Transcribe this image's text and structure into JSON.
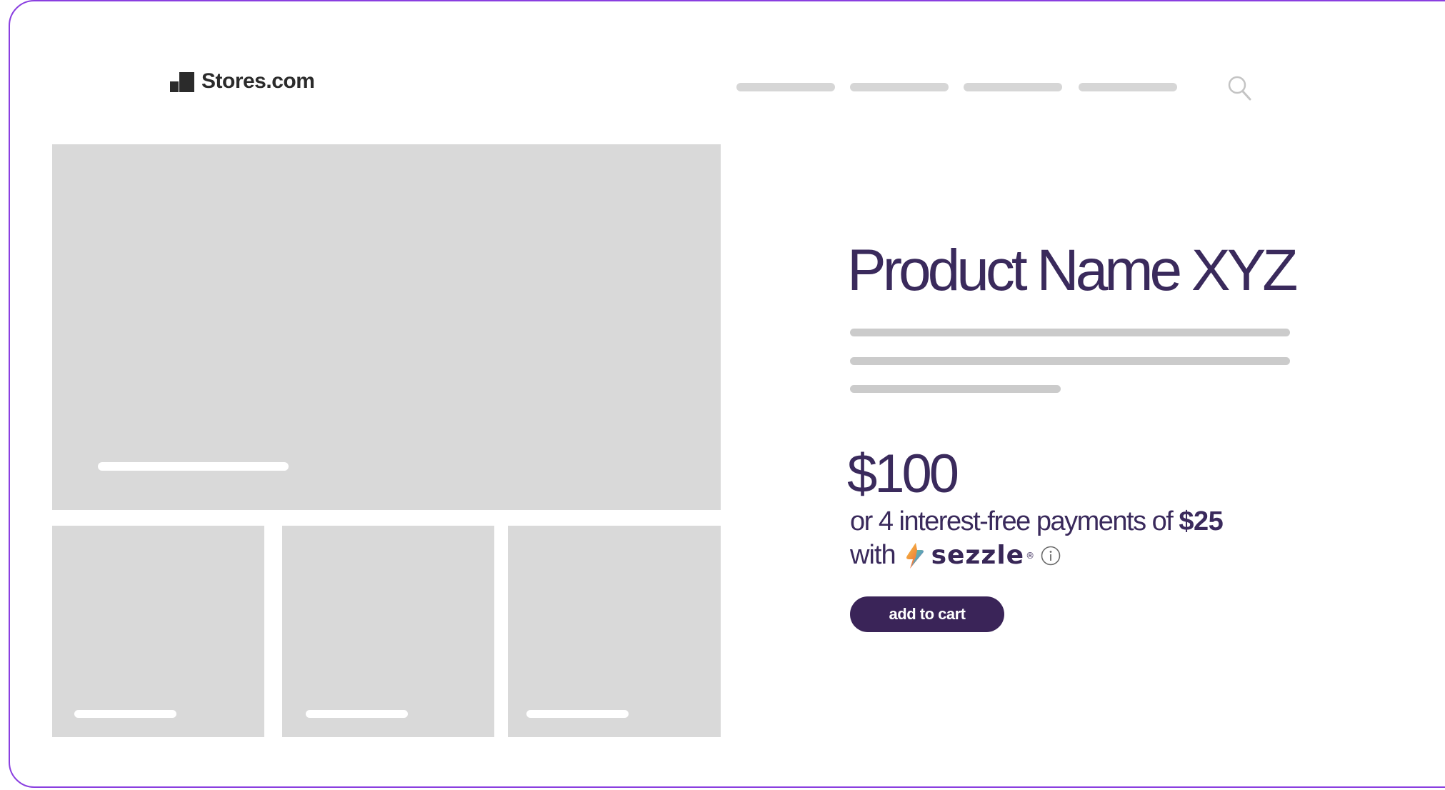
{
  "header": {
    "logo_text": "Stores.com",
    "nav_items": [
      "",
      "",
      "",
      ""
    ],
    "search_icon": "search-icon"
  },
  "product": {
    "name": "Product Name XYZ",
    "price": "$100",
    "installment_prefix": "or 4 interest-free payments of ",
    "installment_amount": "$25",
    "with_text": "with",
    "provider_name": "sezzle",
    "provider_mark": "®",
    "info_icon": "info-icon",
    "add_to_cart_label": "add to cart"
  },
  "colors": {
    "frame_border": "#8a3fe0",
    "brand_dark": "#3a2458",
    "text_primary": "#3a2a5c",
    "placeholder_gray": "#d9d9d9"
  }
}
